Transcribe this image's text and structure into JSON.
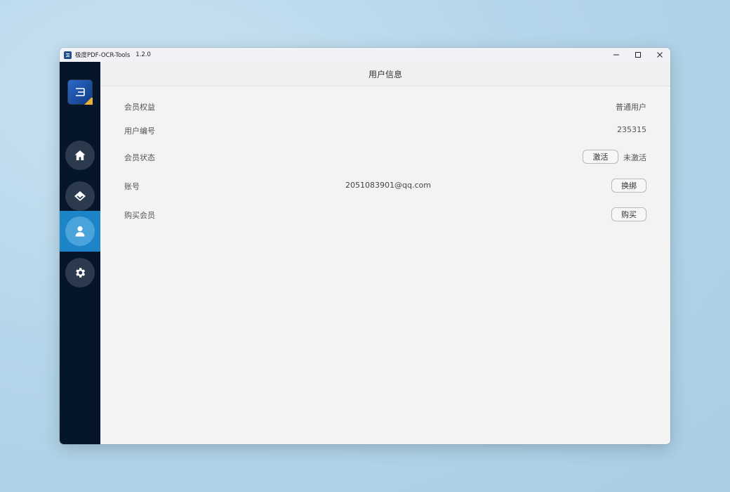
{
  "window": {
    "title": "极度PDF-OCR-Tools",
    "version": "1.2.0"
  },
  "header": {
    "title": "用户信息"
  },
  "sidebar": {
    "items": [
      {
        "icon": "home-icon"
      },
      {
        "icon": "diamond-icon"
      },
      {
        "icon": "user-icon",
        "active": true
      },
      {
        "icon": "gear-icon"
      }
    ]
  },
  "user_info": {
    "membership_label": "会员权益",
    "membership_value": "普通用户",
    "user_id_label": "用户编号",
    "user_id_value": "235315",
    "status_label": "会员状态",
    "activate_button": "激活",
    "status_value": "未激活",
    "account_label": "账号",
    "account_value": "2051083901@qq.com",
    "rebind_button": "换绑",
    "buy_label": "购买会员",
    "buy_button": "购买"
  },
  "colors": {
    "sidebar_bg": "#06162a",
    "active_item": "#1d84c7",
    "content_bg": "#f3f3f3"
  }
}
